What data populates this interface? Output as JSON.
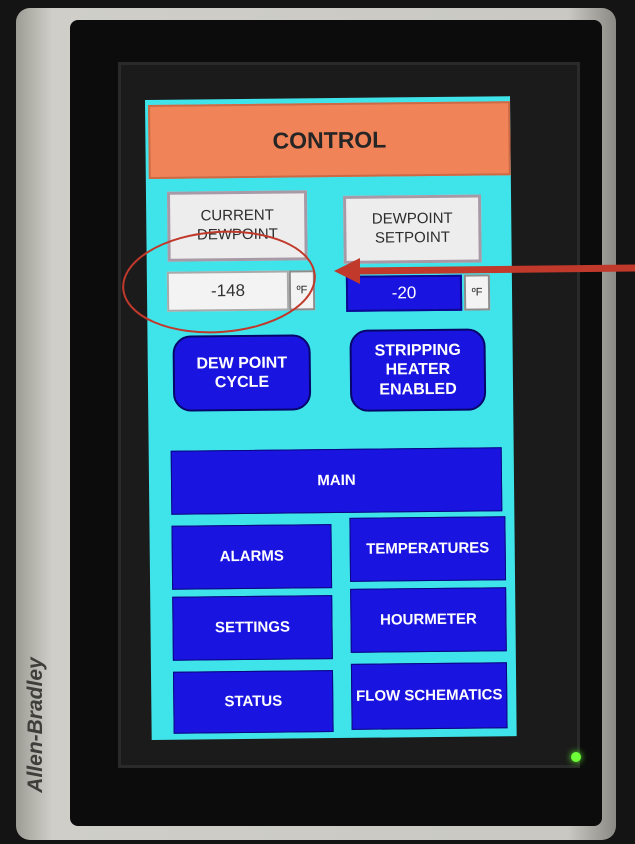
{
  "device": {
    "brand": "Allen-Bradley"
  },
  "header": {
    "title": "CONTROL"
  },
  "readouts": {
    "current_label": "CURRENT DEWPOINT",
    "current_value": "-148",
    "current_unit": "ºF",
    "setpoint_label": "DEWPOINT SETPOINT",
    "setpoint_value": "-20",
    "setpoint_unit": "ºF"
  },
  "status": {
    "cycle": "DEW POINT CYCLE",
    "heater": "STRIPPING HEATER ENABLED"
  },
  "nav": {
    "main": "MAIN",
    "alarms": "ALARMS",
    "temperatures": "TEMPERATURES",
    "settings": "SETTINGS",
    "hourmeter": "HOURMETER",
    "status": "STATUS",
    "flow": "FLOW SCHEMATICS"
  },
  "colors": {
    "screen_bg": "#3fe4ea",
    "title_bg": "#f08458",
    "button_blue": "#1a14e0",
    "annotation_red": "#c0392b",
    "led_green": "#6eff38"
  },
  "icons": {
    "annotation_circle": "red-ellipse",
    "annotation_arrow": "red-arrow-left"
  }
}
